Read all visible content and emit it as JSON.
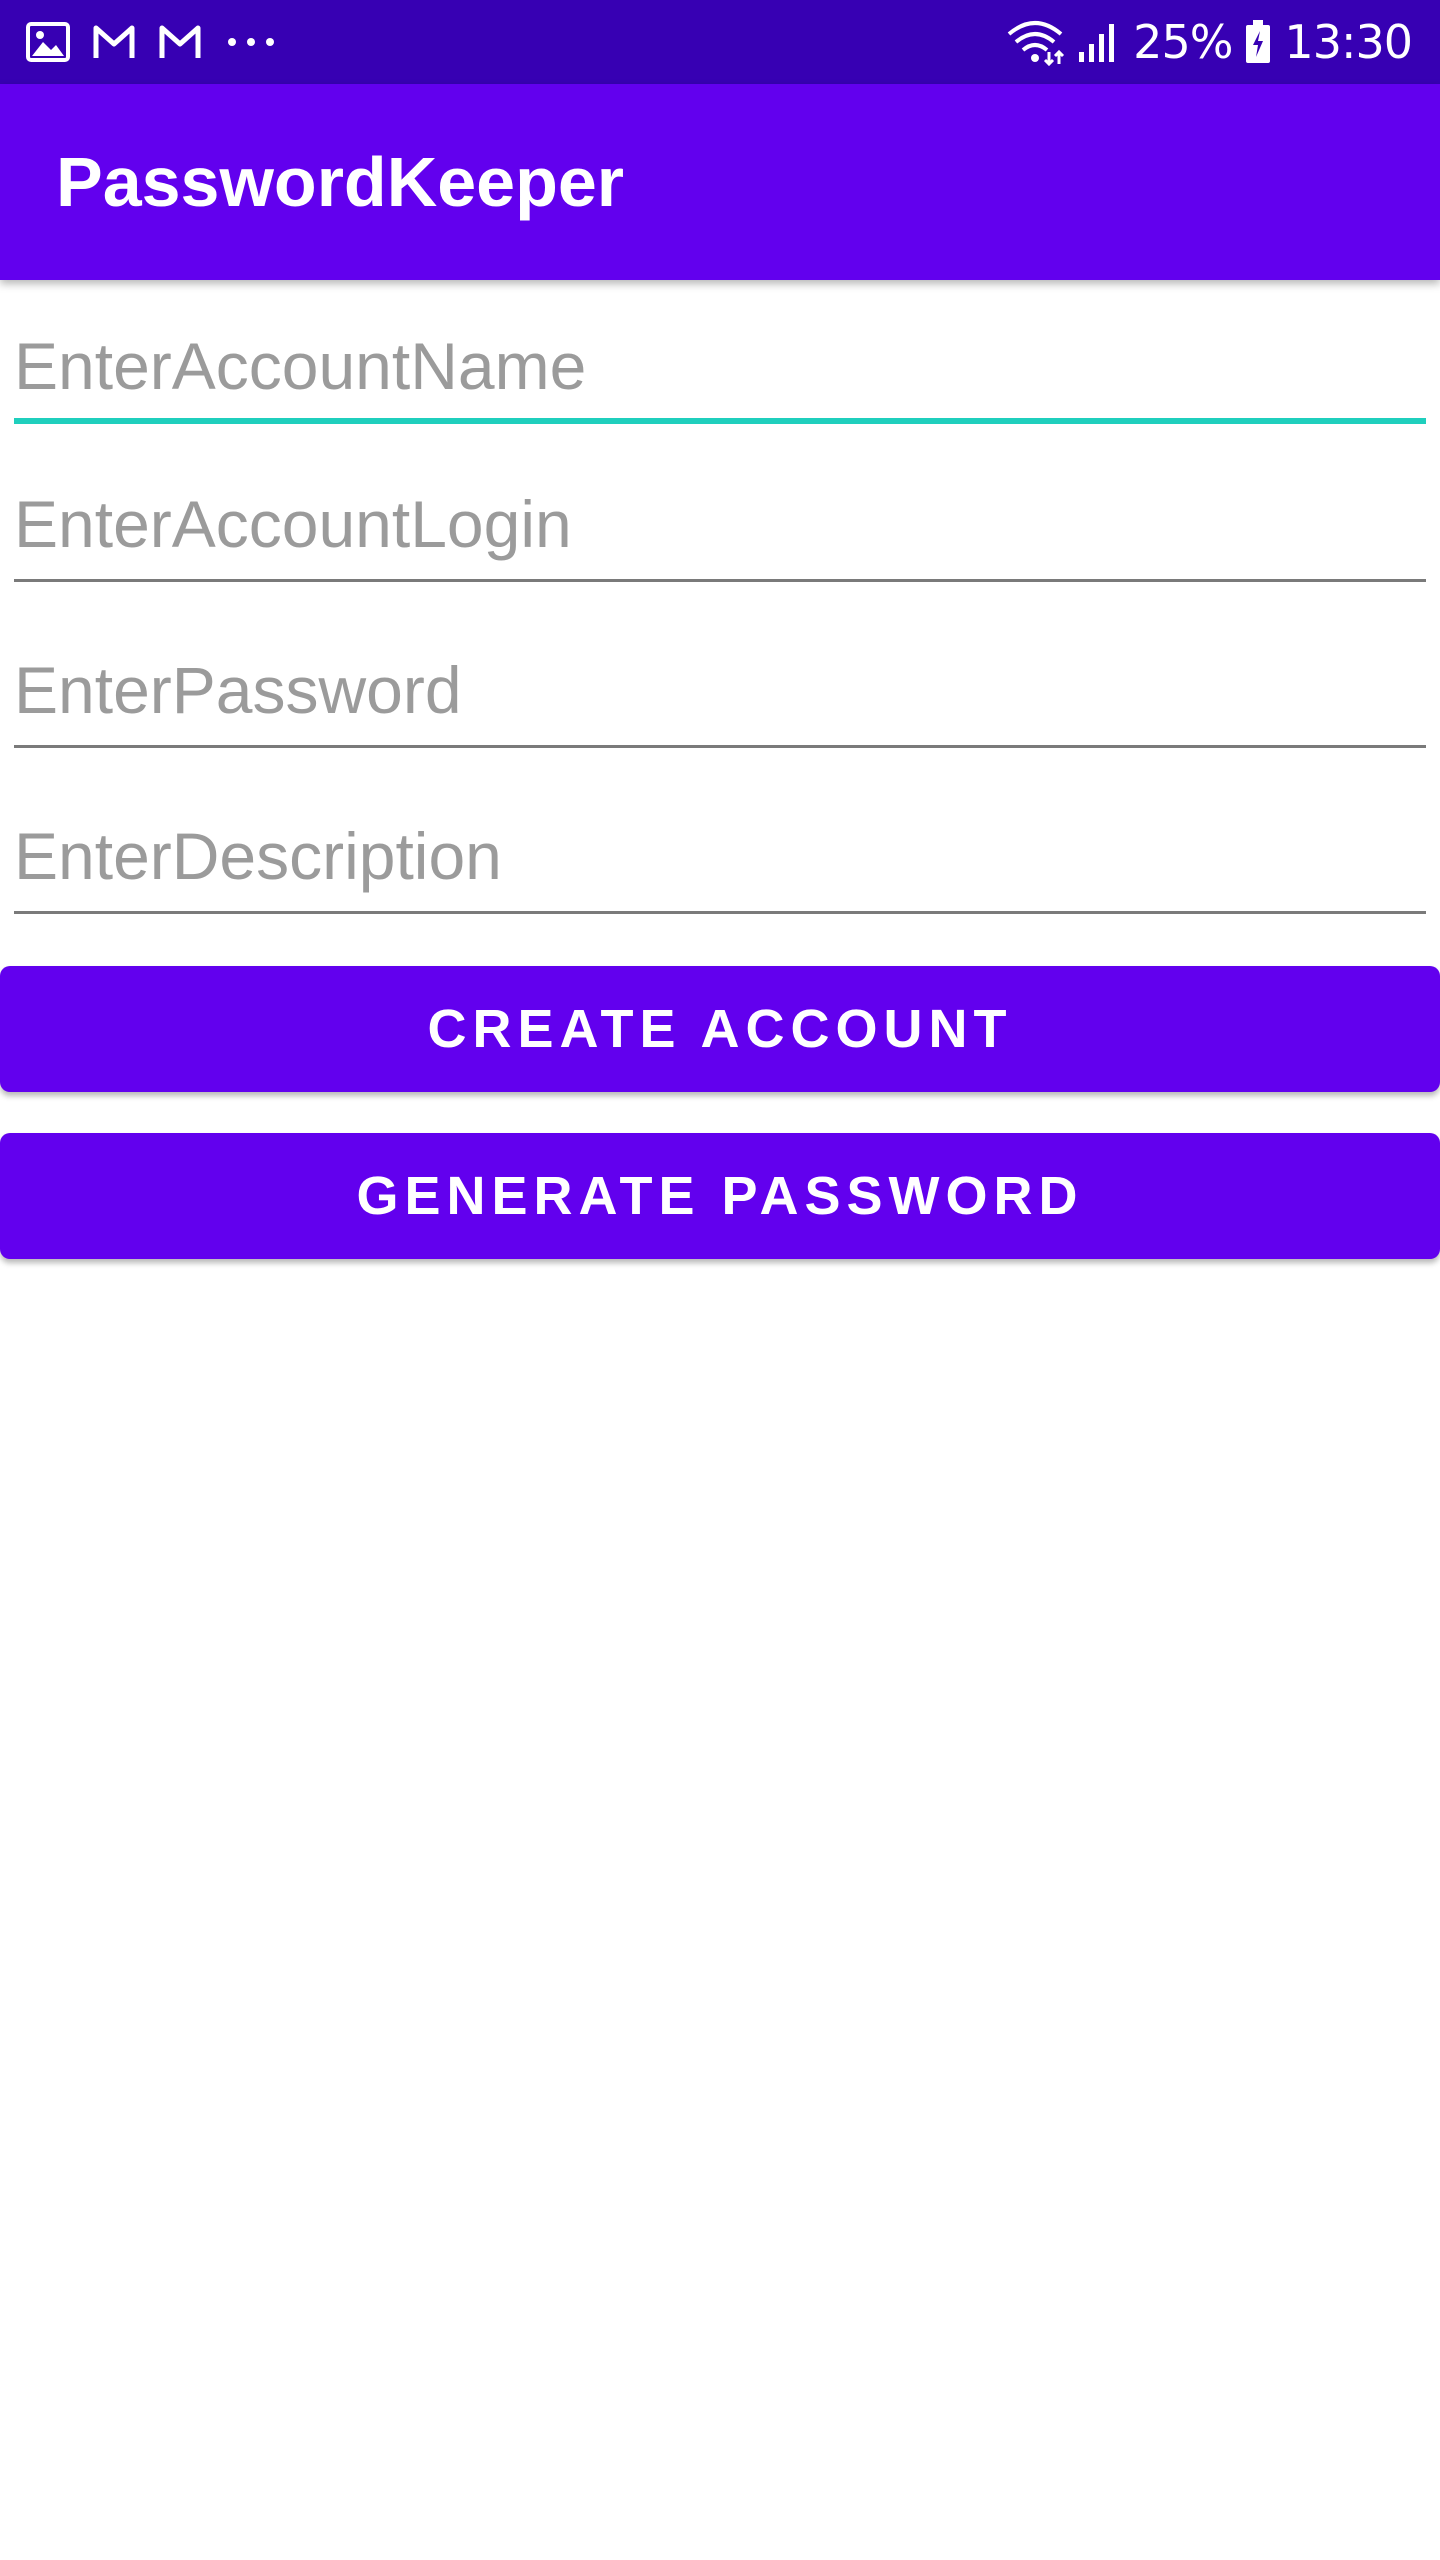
{
  "status_bar": {
    "battery": "25%",
    "time": "13:30",
    "icons": [
      "gallery-icon",
      "gmail-icon",
      "gmail-icon",
      "more-icon",
      "wifi-icon",
      "signal-icon",
      "battery-icon"
    ]
  },
  "app_bar": {
    "title": "PasswordKeeper"
  },
  "form": {
    "account_name": {
      "placeholder": "EnterAccountName",
      "value": ""
    },
    "account_login": {
      "placeholder": "EnterAccountLogin",
      "value": ""
    },
    "password": {
      "placeholder": "EnterPassword",
      "value": ""
    },
    "description": {
      "placeholder": "EnterDescription",
      "value": ""
    }
  },
  "buttons": {
    "create_account": "CREATE ACCOUNT",
    "generate_password": "GENERATE PASSWORD"
  },
  "colors": {
    "status_bar": "#3700b3",
    "primary": "#6200ee",
    "focus_underline": "#1fcfbd",
    "hint_text": "#9b9b9b",
    "underline": "#7a7a7a"
  }
}
